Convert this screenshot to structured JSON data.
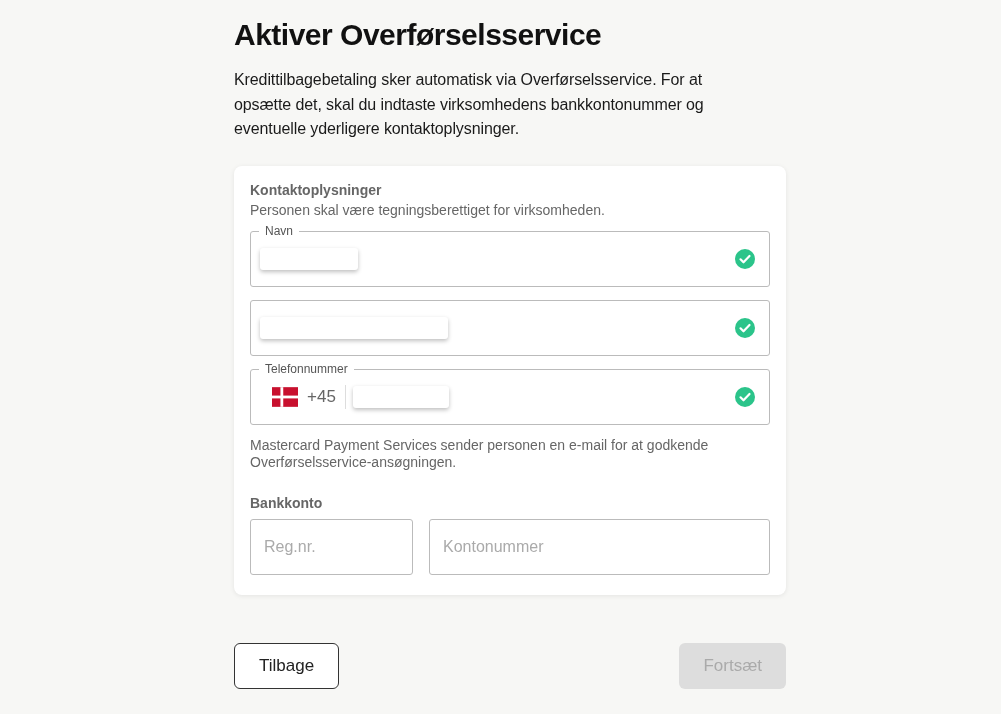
{
  "title": "Aktiver Overførselsservice",
  "intro": "Kredittilbagebetaling sker automatisk via Overførselsservice. For at opsætte det, skal du indtaste virksomhedens bankkontonummer og eventuelle yderligere kontaktoplysninger.",
  "contact": {
    "heading": "Kontaktoplysninger",
    "subtitle": "Personen skal være tegningsberettiget for virksomheden.",
    "fields": [
      {
        "kind": "name",
        "label": "Navn",
        "redacted": true,
        "valid": true
      },
      {
        "kind": "email",
        "redacted": true,
        "valid": true
      },
      {
        "kind": "phone",
        "label": "Telefonnummer",
        "prefix": "+45",
        "redacted": true,
        "valid": true
      }
    ],
    "note": "Mastercard Payment Services sender personen en e-mail for at godkende Overførselsservice-ansøgningen."
  },
  "bank": {
    "heading": "Bankkonto",
    "fields": [
      {
        "kind": "short",
        "placeholder": "Reg.nr."
      },
      {
        "kind": "wide",
        "placeholder": "Kontonummer"
      }
    ]
  },
  "buttons": [
    {
      "kind": "back",
      "label": "Tilbage",
      "disabled": false
    },
    {
      "kind": "next",
      "label": "Fortsæt",
      "disabled": true
    }
  ]
}
